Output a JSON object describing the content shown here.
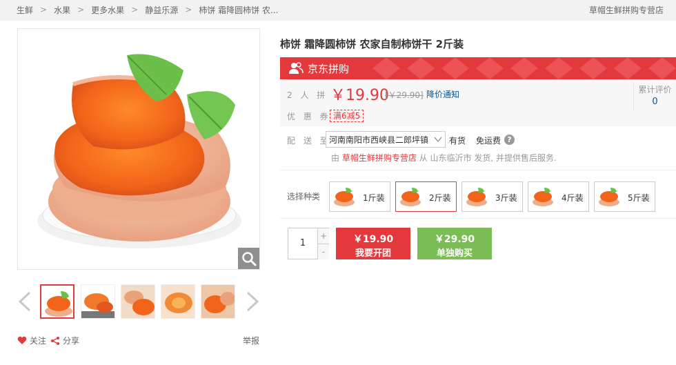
{
  "breadcrumb": {
    "items": [
      "生鲜",
      "水果",
      "更多水果",
      "静益乐源",
      "柿饼 霜降圆柿饼 农..."
    ],
    "separator": ">"
  },
  "shop_name": "草帽生鲜拼购专营店",
  "gallery": {
    "zoom_icon": "magnifier-icon",
    "prev_icon": "chevron-left-icon",
    "next_icon": "chevron-right-icon",
    "thumb_count": 5,
    "active_thumb": 0
  },
  "actions": {
    "follow": "关注",
    "share": "分享",
    "report": "举报"
  },
  "product": {
    "title": "柿饼 霜降圆柿饼 农家自制柿饼干 2斤装"
  },
  "banner": {
    "label": "京东拼购",
    "icon": "users-icon",
    "color": "#e4393c"
  },
  "price": {
    "group_label": "2 人 拼",
    "current": "￥19.90",
    "original": "[￥29.90]",
    "notify": "降价通知",
    "coupon_label": "优 惠 券",
    "coupon": "满6减5",
    "review_label": "累计评价",
    "review_count": "0"
  },
  "delivery": {
    "label": "配 送 至",
    "address": "河南南阳市西峡县二郎坪镇",
    "stock": "有货",
    "shipping": "免运费",
    "help_icon": "question-icon",
    "ship_prefix": "由",
    "ship_shop": "草帽生鲜拼购专营店",
    "ship_suffix": "从 山东临沂市 发货, 并提供售后服务."
  },
  "variants": {
    "label": "选择种类",
    "selected": 1,
    "options": [
      "1斤装",
      "2斤装",
      "3斤装",
      "4斤装",
      "5斤装"
    ]
  },
  "purchase": {
    "quantity": "1",
    "plus": "+",
    "minus": "-",
    "group_price": "￥19.90",
    "group_label": "我要开团",
    "group_color": "#e4393c",
    "single_price": "￥29.90",
    "single_label": "单独购买",
    "single_color": "#7abd54"
  }
}
